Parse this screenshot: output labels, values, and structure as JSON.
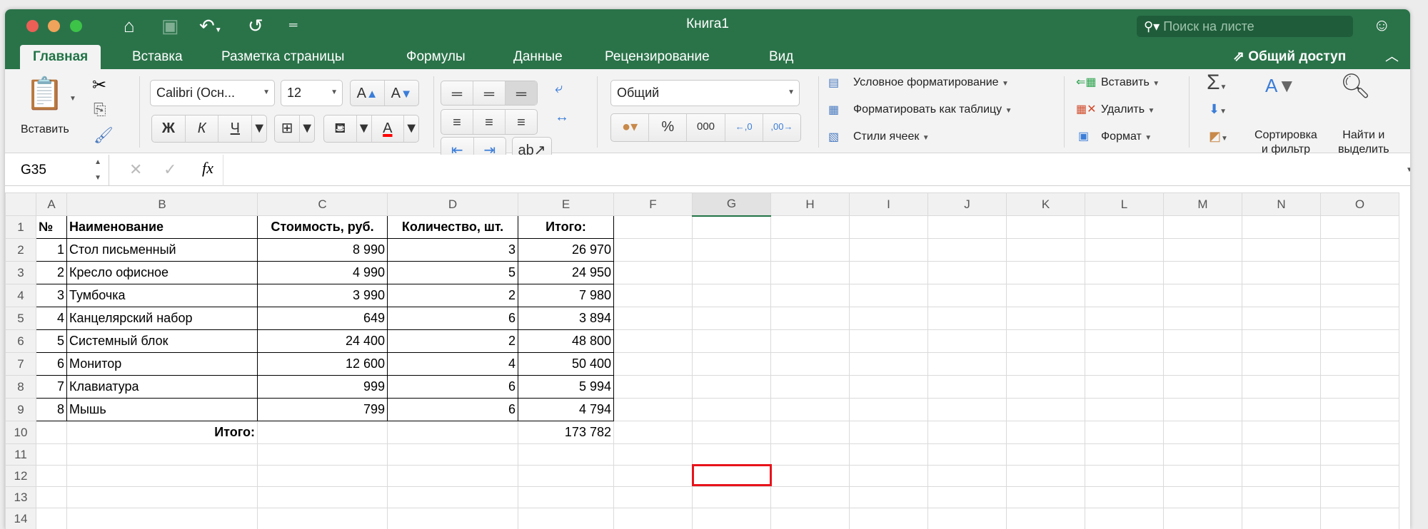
{
  "window": {
    "title": "Книга1",
    "search_placeholder": "Поиск на листе"
  },
  "tabs": [
    "Главная",
    "Вставка",
    "Разметка страницы",
    "Формулы",
    "Данные",
    "Рецензирование",
    "Вид"
  ],
  "share_label": "Общий доступ",
  "ribbon": {
    "paste_label": "Вставить",
    "font_name": "Calibri (Осн...",
    "font_size": "12",
    "bold": "Ж",
    "italic": "К",
    "underline": "Ч",
    "font_color": "#ff0000",
    "number_format": "Общий",
    "percent": "%",
    "thousands": "000",
    "conditional_formatting": "Условное форматирование",
    "format_as_table": "Форматировать как таблицу",
    "cell_styles": "Стили ячеек",
    "insert": "Вставить",
    "delete": "Удалить",
    "format": "Формат",
    "sort_filter": [
      "Сортировка",
      "и фильтр"
    ],
    "find_select": [
      "Найти и",
      "выделить"
    ]
  },
  "formula_bar": {
    "name_box": "G35",
    "fx": "fx",
    "value": ""
  },
  "columns": [
    "A",
    "B",
    "C",
    "D",
    "E",
    "F",
    "G",
    "H",
    "I",
    "J",
    "K",
    "L",
    "M",
    "N",
    "O"
  ],
  "selected_column": "G",
  "rows": [
    [
      "№",
      "Наименование",
      "Стоимость, руб.",
      "Количество, шт.",
      "Итого:"
    ],
    [
      "1",
      "Стол письменный",
      "8 990",
      "3",
      "26 970"
    ],
    [
      "2",
      "Кресло офисное",
      "4 990",
      "5",
      "24 950"
    ],
    [
      "3",
      "Тумбочка",
      "3 990",
      "2",
      "7 980"
    ],
    [
      "4",
      "Канцелярский набор",
      "649",
      "6",
      "3 894"
    ],
    [
      "5",
      "Системный блок",
      "24 400",
      "2",
      "48 800"
    ],
    [
      "6",
      "Монитор",
      "12 600",
      "4",
      "50 400"
    ],
    [
      "7",
      "Клавиатура",
      "999",
      "6",
      "5 994"
    ],
    [
      "8",
      "Мышь",
      "799",
      "6",
      "4 794"
    ],
    [
      "",
      "Итого:",
      "",
      "",
      "173 782"
    ],
    [
      "",
      "",
      "",
      "",
      ""
    ],
    [
      "",
      "",
      "",
      "",
      ""
    ],
    [
      "",
      "",
      "",
      "",
      ""
    ],
    [
      "",
      "",
      "",
      "",
      ""
    ]
  ],
  "colors": {
    "accent": "#2a7349",
    "selection": "#e8131b"
  }
}
